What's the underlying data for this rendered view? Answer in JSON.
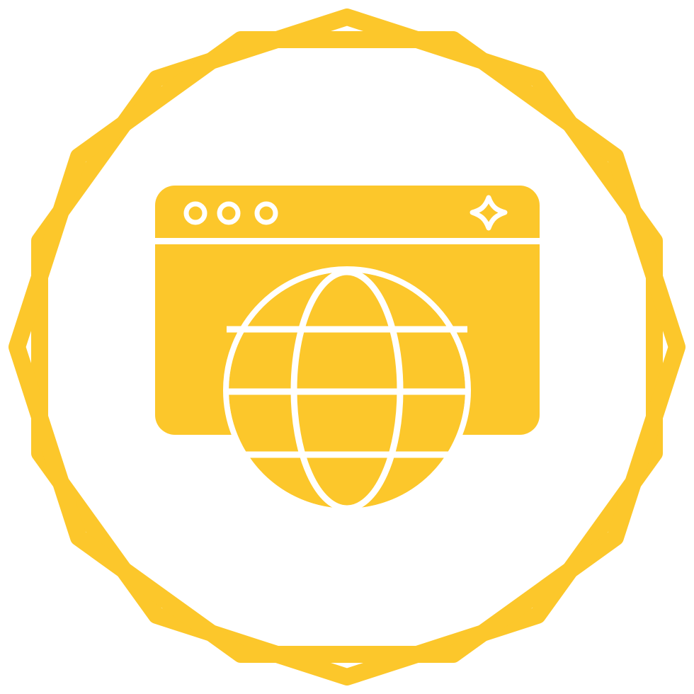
{
  "icon": {
    "name": "web-browser-globe-icon",
    "colors": {
      "primary": "#FCC72B",
      "background": "#FFFFFF"
    },
    "parts": {
      "badge": "double-decagon-badge",
      "window": "browser-window",
      "dots": [
        "window-dot",
        "window-dot",
        "window-dot"
      ],
      "sparkle": "sparkle-icon",
      "globe": "globe-icon"
    }
  }
}
